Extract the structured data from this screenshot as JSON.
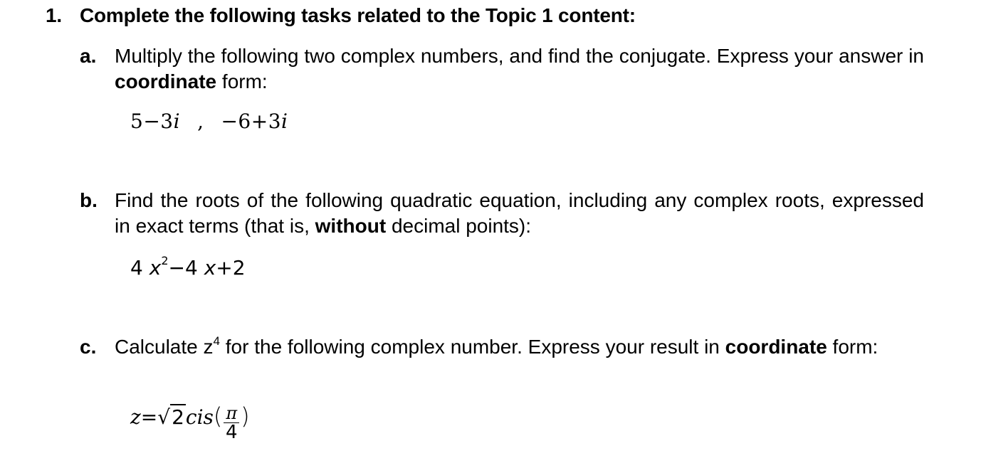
{
  "question": {
    "number": "1.",
    "title": "Complete the following tasks related to the Topic 1 content:",
    "items": [
      {
        "label": "a.",
        "text_before": "Multiply the following two complex numbers, and find the conjugate. Express your answer in ",
        "bold": "coordinate",
        "text_after": " form:",
        "math": {
          "first": "5−3",
          "first_var": "i",
          "separator": ",",
          "second": "−6+3",
          "second_var": "i"
        }
      },
      {
        "label": "b.",
        "text_before": "Find the roots of the following quadratic equation, including any complex roots, expressed in exact terms (that is, ",
        "bold": "without",
        "text_after": " decimal points):",
        "math": {
          "coef1": "4",
          "var1": "x",
          "exp": "2",
          "op1": "−4",
          "var2": "x",
          "tail": "+2"
        }
      },
      {
        "label": "c.",
        "text_before": "Calculate z",
        "superscript": "4",
        "text_middle": " for the following complex number. Express your result in ",
        "bold": "coordinate",
        "text_after": " form:",
        "math": {
          "lhs": "z=",
          "sqrt_symbol": "√",
          "radicand": "2",
          "func": "cis",
          "open_paren": "(",
          "numerator": "π",
          "denominator": "4",
          "close_paren": ")"
        }
      }
    ]
  }
}
